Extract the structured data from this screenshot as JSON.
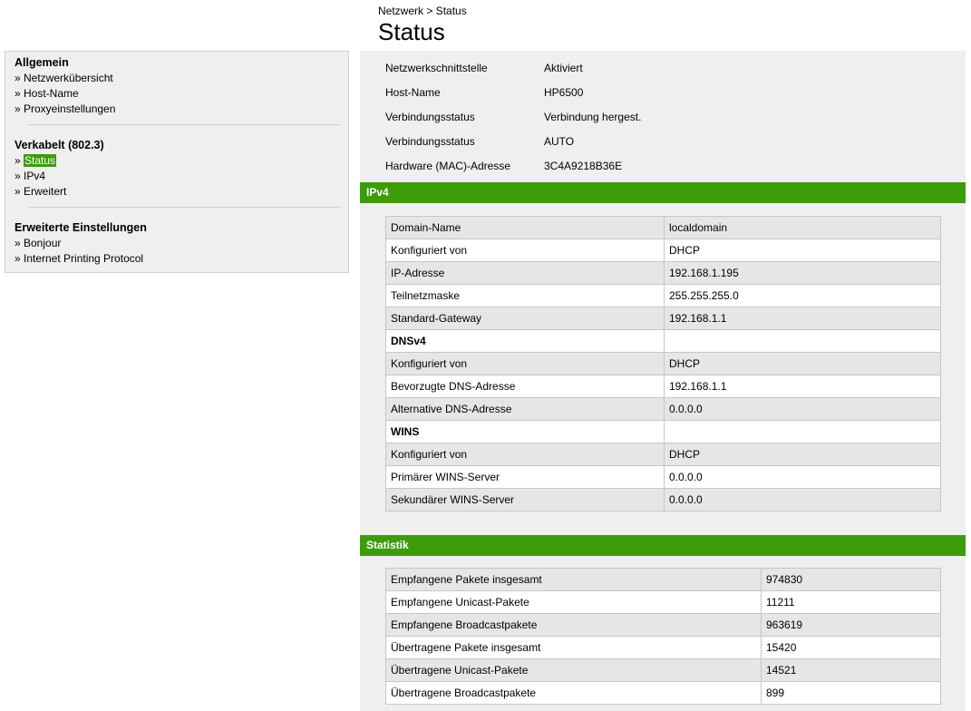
{
  "breadcrumb": "Netzwerk > Status",
  "title": "Status",
  "sidebar": {
    "groups": [
      {
        "heading": "Allgemein",
        "items": [
          "» Netzwerkübersicht",
          "» Host-Name",
          "» Proxyeinstellungen"
        ]
      },
      {
        "heading": "Verkabelt (802.3)",
        "items": [
          "» ",
          "Status",
          "» IPv4",
          "» Erweitert"
        ]
      },
      {
        "heading": "Erweiterte Einstellungen",
        "items": [
          "» Bonjour",
          "» Internet Printing Protocol"
        ]
      }
    ]
  },
  "info": [
    {
      "label": "Netzwerkschnittstelle",
      "value": "Aktiviert"
    },
    {
      "label": "Host-Name",
      "value": "HP6500"
    },
    {
      "label": "Verbindungsstatus",
      "value": "Verbindung hergest."
    },
    {
      "label": "Verbindungsstatus",
      "value": "AUTO"
    },
    {
      "label": "Hardware (MAC)-Adresse",
      "value": "3C4A9218B36E"
    }
  ],
  "ipv4": {
    "heading": "IPv4",
    "rows": [
      {
        "k": "Domain-Name",
        "v": "localdomain"
      },
      {
        "k": "Konfiguriert von",
        "v": "DHCP"
      },
      {
        "k": "IP-Adresse",
        "v": "192.168.1.195"
      },
      {
        "k": "Teilnetzmaske",
        "v": "255.255.255.0"
      },
      {
        "k": "Standard-Gateway",
        "v": "192.168.1.1"
      },
      {
        "k": "DNSv4",
        "v": ""
      },
      {
        "k": "Konfiguriert von",
        "v": "DHCP"
      },
      {
        "k": "Bevorzugte DNS-Adresse",
        "v": "192.168.1.1"
      },
      {
        "k": "Alternative DNS-Adresse",
        "v": "0.0.0.0"
      },
      {
        "k": "WINS",
        "v": ""
      },
      {
        "k": "Konfiguriert von",
        "v": "DHCP"
      },
      {
        "k": "Primärer WINS-Server",
        "v": "0.0.0.0"
      },
      {
        "k": "Sekundärer WINS-Server",
        "v": "0.0.0.0"
      }
    ]
  },
  "statistik": {
    "heading": "Statistik",
    "rows": [
      {
        "k": "Empfangene Pakete insgesamt",
        "v": "974830"
      },
      {
        "k": "Empfangene Unicast-Pakete",
        "v": "11211"
      },
      {
        "k": "Empfangene Broadcastpakete",
        "v": "963619"
      },
      {
        "k": "Übertragene Pakete insgesamt",
        "v": "15420"
      },
      {
        "k": "Übertragene Unicast-Pakete",
        "v": "14521"
      },
      {
        "k": "Übertragene Broadcastpakete",
        "v": "899"
      }
    ]
  },
  "colors": {
    "accent": "#3c9c0a",
    "panel": "#efefef",
    "row_alt": "#e6e6e6"
  }
}
